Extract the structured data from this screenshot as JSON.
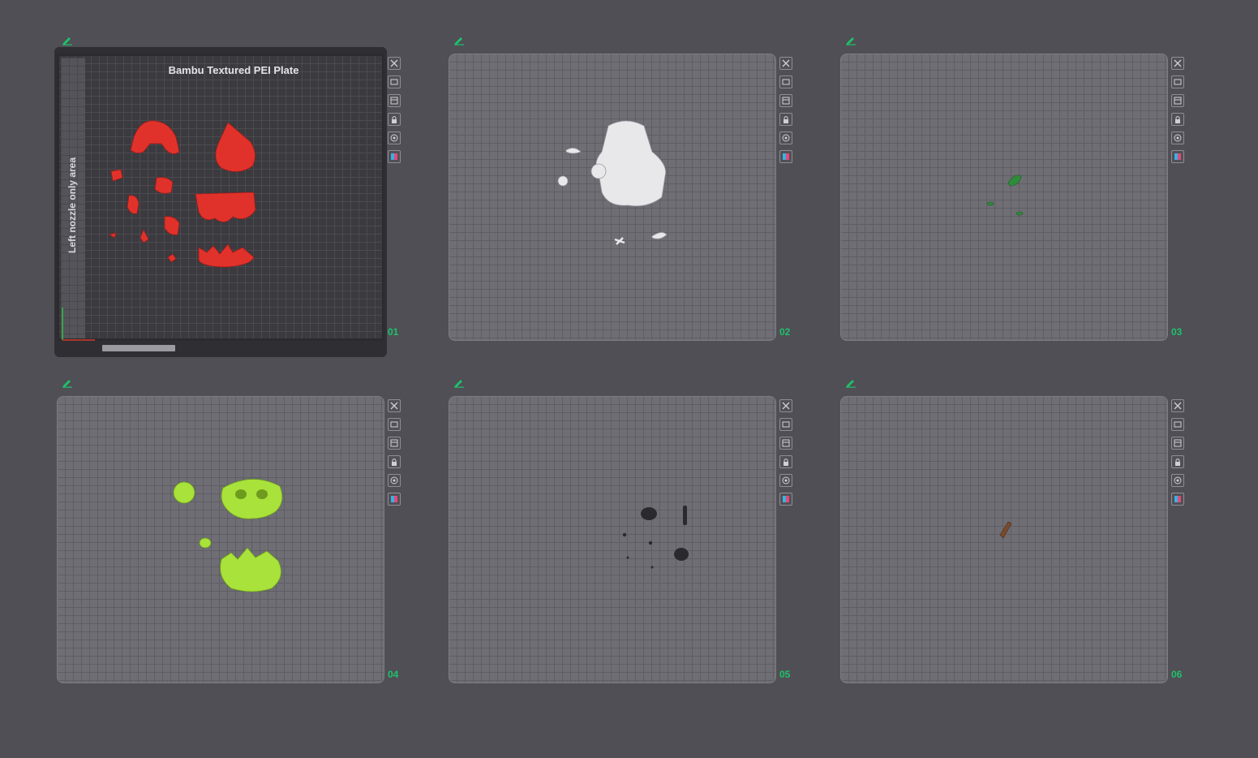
{
  "colors": {
    "accent": "#1fc16b",
    "plate1_objects": "#e0322b",
    "plate2_objects": "#e8e8ea",
    "plate3_objects": "#2e8b3a",
    "plate4_objects": "#a8e23a",
    "plate5_objects": "#2a2a2e",
    "plate6_objects": "#7a4a2a"
  },
  "plates": [
    {
      "number": "01",
      "title": "Bambu Textured PEI Plate",
      "side_label": "Left nozzle only area"
    },
    {
      "number": "02"
    },
    {
      "number": "03"
    },
    {
      "number": "04"
    },
    {
      "number": "05"
    },
    {
      "number": "06"
    }
  ],
  "plate_tools": [
    "close-icon",
    "arrange-icon",
    "orient-icon",
    "lock-icon",
    "settings-icon",
    "filament-icon"
  ]
}
